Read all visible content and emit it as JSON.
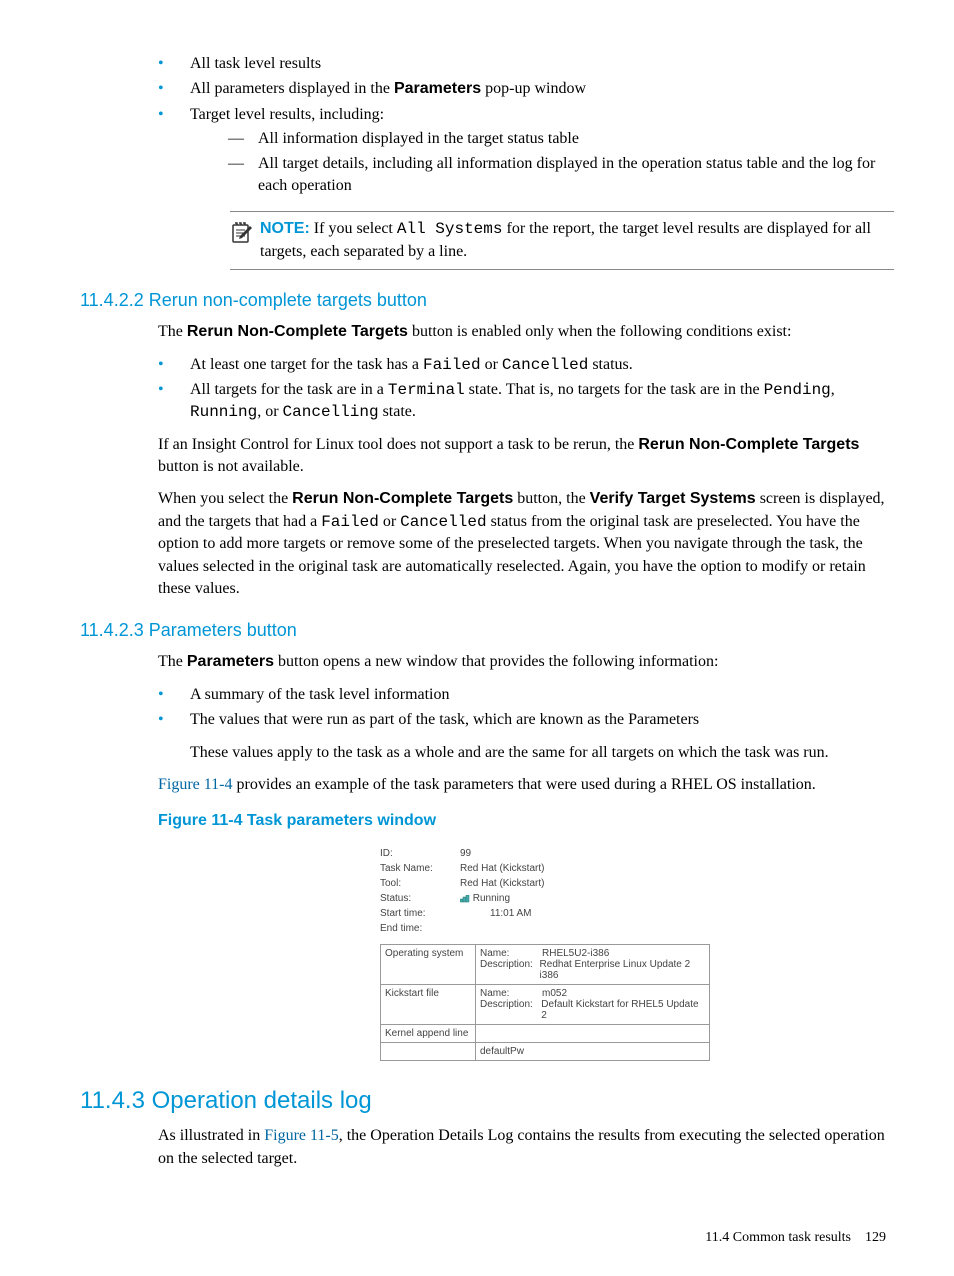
{
  "list1": {
    "item1": "All task level results",
    "item2_pre": "All parameters displayed in the ",
    "item2_bold": "Parameters",
    "item2_post": " pop-up window",
    "item3": "Target level results, including:",
    "sub1": "All information displayed in the target status table",
    "sub2": "All target details, including all information displayed in the operation status table and the log for each operation"
  },
  "note": {
    "label": "NOTE:",
    "pre": "  If you select ",
    "code": "All Systems",
    "post": " for the report, the target level results are displayed for all targets, each separated by a line."
  },
  "sec_11_4_2_2": {
    "title": "11.4.2.2 Rerun non-complete targets button",
    "intro_pre": "The ",
    "intro_bold": "Rerun Non-Complete Targets",
    "intro_post": " button is enabled only when the following conditions exist:",
    "b1_pre": "At least one target for the task has a ",
    "b1_c1": "Failed",
    "b1_mid": " or ",
    "b1_c2": "Cancelled",
    "b1_post": " status.",
    "b2_pre": "All targets for the task are in a ",
    "b2_c1": "Terminal",
    "b2_mid": " state. That is, no targets for the task are in the ",
    "b2_c2": "Pending",
    "b2_sep1": ", ",
    "b2_c3": "Running",
    "b2_sep2": ", or ",
    "b2_c4": "Cancelling",
    "b2_post": " state.",
    "p2_pre": "If an Insight Control for Linux tool does not support a task to be rerun, the ",
    "p2_bold": "Rerun Non-Complete Targets",
    "p2_post": " button is not available.",
    "p3_1": "When you select the ",
    "p3_b1": "Rerun Non-Complete Targets",
    "p3_2": " button, the ",
    "p3_b2": "Verify Target Systems",
    "p3_3": " screen is displayed, and the targets that had a ",
    "p3_c1": "Failed",
    "p3_4": " or ",
    "p3_c2": "Cancelled",
    "p3_5": " status from the original task are preselected. You have the option to add more targets or remove some of the preselected targets. When you navigate through the task, the values selected in the original task are automatically reselected. Again, you have the option to modify or retain these values."
  },
  "sec_11_4_2_3": {
    "title": "11.4.2.3 Parameters button",
    "intro_pre": "The ",
    "intro_bold": "Parameters",
    "intro_post": " button opens a new window that provides the following information:",
    "b1": "A summary of the task level information",
    "b2": "The values that were run as part of the task, which are known as the Parameters",
    "b2_sub": "These values apply to the task as a whole and are the same for all targets on which the task was run.",
    "p_link": "Figure 11-4",
    "p_rest": " provides an example of the task parameters that were used during a RHEL OS installation.",
    "figcap": "Figure 11-4 Task parameters window"
  },
  "fig": {
    "id_k": "ID:",
    "id_v": "99",
    "tn_k": "Task Name:",
    "tn_v": "Red Hat (Kickstart)",
    "tool_k": "Tool:",
    "tool_v": "Red Hat (Kickstart)",
    "status_k": "Status:",
    "status_v": " Running",
    "start_k": "Start time:",
    "start_v": "11:01 AM",
    "end_k": "End time:",
    "end_v": "",
    "r1_left": "Operating system",
    "r1_name_k": "Name:",
    "r1_name_v": "RHEL5U2-i386",
    "r1_desc_k": "Description:",
    "r1_desc_v": "Redhat Enterprise Linux Update 2 i386",
    "r2_left": "Kickstart file",
    "r2_name_k": "Name:",
    "r2_name_v": "m052",
    "r2_desc_k": "Description:",
    "r2_desc_v": "Default Kickstart for RHEL5 Update 2",
    "r3_left": "Kernel append line",
    "r4_val": "defaultPw"
  },
  "sec_11_4_3": {
    "title": "11.4.3 Operation details log",
    "p_pre": "As illustrated in ",
    "p_link": "Figure 11-5",
    "p_post": ", the Operation Details Log contains the results from executing the selected operation on the selected target."
  },
  "footer": {
    "left": "11.4 Common task results",
    "page": "129"
  }
}
